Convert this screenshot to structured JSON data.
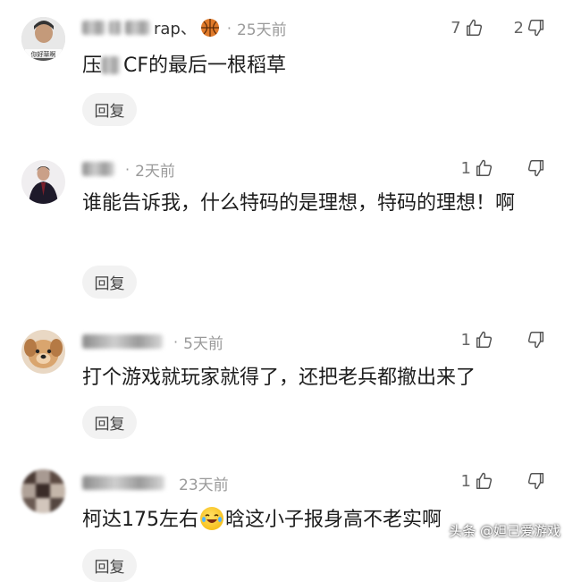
{
  "comments": [
    {
      "username_visible": "rap、",
      "time": "25天前",
      "likes": "7",
      "dislikes": "2",
      "text_before": "压",
      "text_after": "CF的最后一根稻草",
      "reply_label": "回复",
      "avatar_text": "你好草啊"
    },
    {
      "username_visible": "",
      "time": "2天前",
      "likes": "1",
      "dislikes": "",
      "text": "谁能告诉我，什么特码的是理想，特码的理想！啊",
      "reply_label": "回复"
    },
    {
      "username_visible": "",
      "time": "5天前",
      "likes": "1",
      "dislikes": "",
      "text": "打个游戏就玩家就得了，还把老兵都撤出来了",
      "reply_label": "回复"
    },
    {
      "username_visible": "",
      "time": "23天前",
      "likes": "1",
      "dislikes": "",
      "text_before": "柯达175左右",
      "text_after": "晗这小子报身高不老实啊",
      "reply_label": "回复"
    }
  ],
  "watermark": "头条 @妲己爱游戏",
  "icons": {
    "like": "thumbs-up-icon",
    "dislike": "thumbs-down-icon",
    "emoji": "laughing-crying-emoji-icon",
    "badge": "basketball-icon"
  },
  "colors": {
    "time": "#9a9a9a",
    "reply_bg": "#f2f2f2",
    "basketball": "#e07a2a"
  }
}
